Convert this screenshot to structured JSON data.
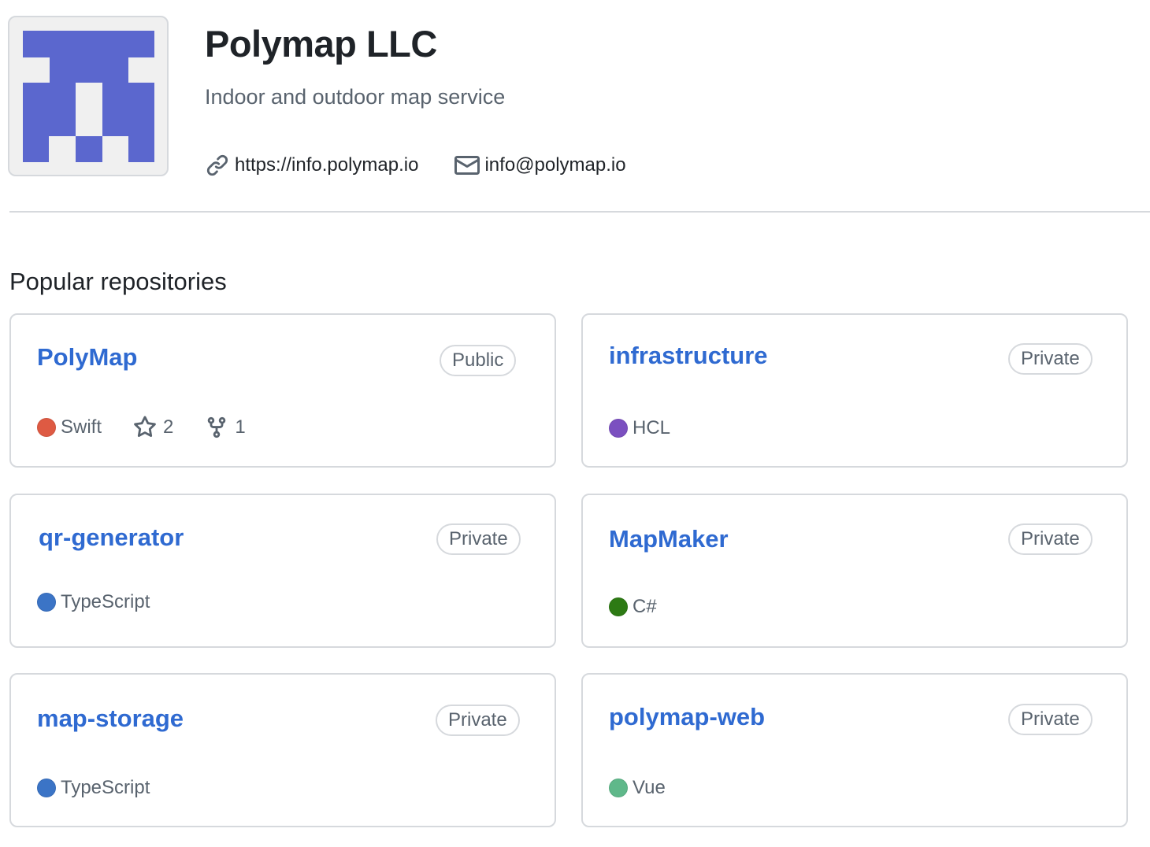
{
  "org": {
    "name": "Polymap LLC",
    "description": "Indoor and outdoor map service",
    "website": "https://info.polymap.io",
    "email": "info@polymap.io",
    "avatar_color": "#5b67ce"
  },
  "section_title": "Popular repositories",
  "repos": [
    {
      "name": "PolyMap",
      "visibility": "Public",
      "language": "Swift",
      "lang_color": "#de5a43",
      "stars": "2",
      "forks": "1"
    },
    {
      "name": "infrastructure",
      "visibility": "Private",
      "language": "HCL",
      "lang_color": "#7b50c0"
    },
    {
      "name": "qr-generator",
      "visibility": "Private",
      "language": "TypeScript",
      "lang_color": "#3b74c6"
    },
    {
      "name": "MapMaker",
      "visibility": "Private",
      "language": "C#",
      "lang_color": "#2d7a14"
    },
    {
      "name": "map-storage",
      "visibility": "Private",
      "language": "TypeScript",
      "lang_color": "#3b74c6"
    },
    {
      "name": "polymap-web",
      "visibility": "Private",
      "language": "Vue",
      "lang_color": "#5fb88a"
    }
  ],
  "icons": {
    "website": "link-icon",
    "email": "mail-icon",
    "stars": "star-icon",
    "forks": "fork-icon"
  }
}
